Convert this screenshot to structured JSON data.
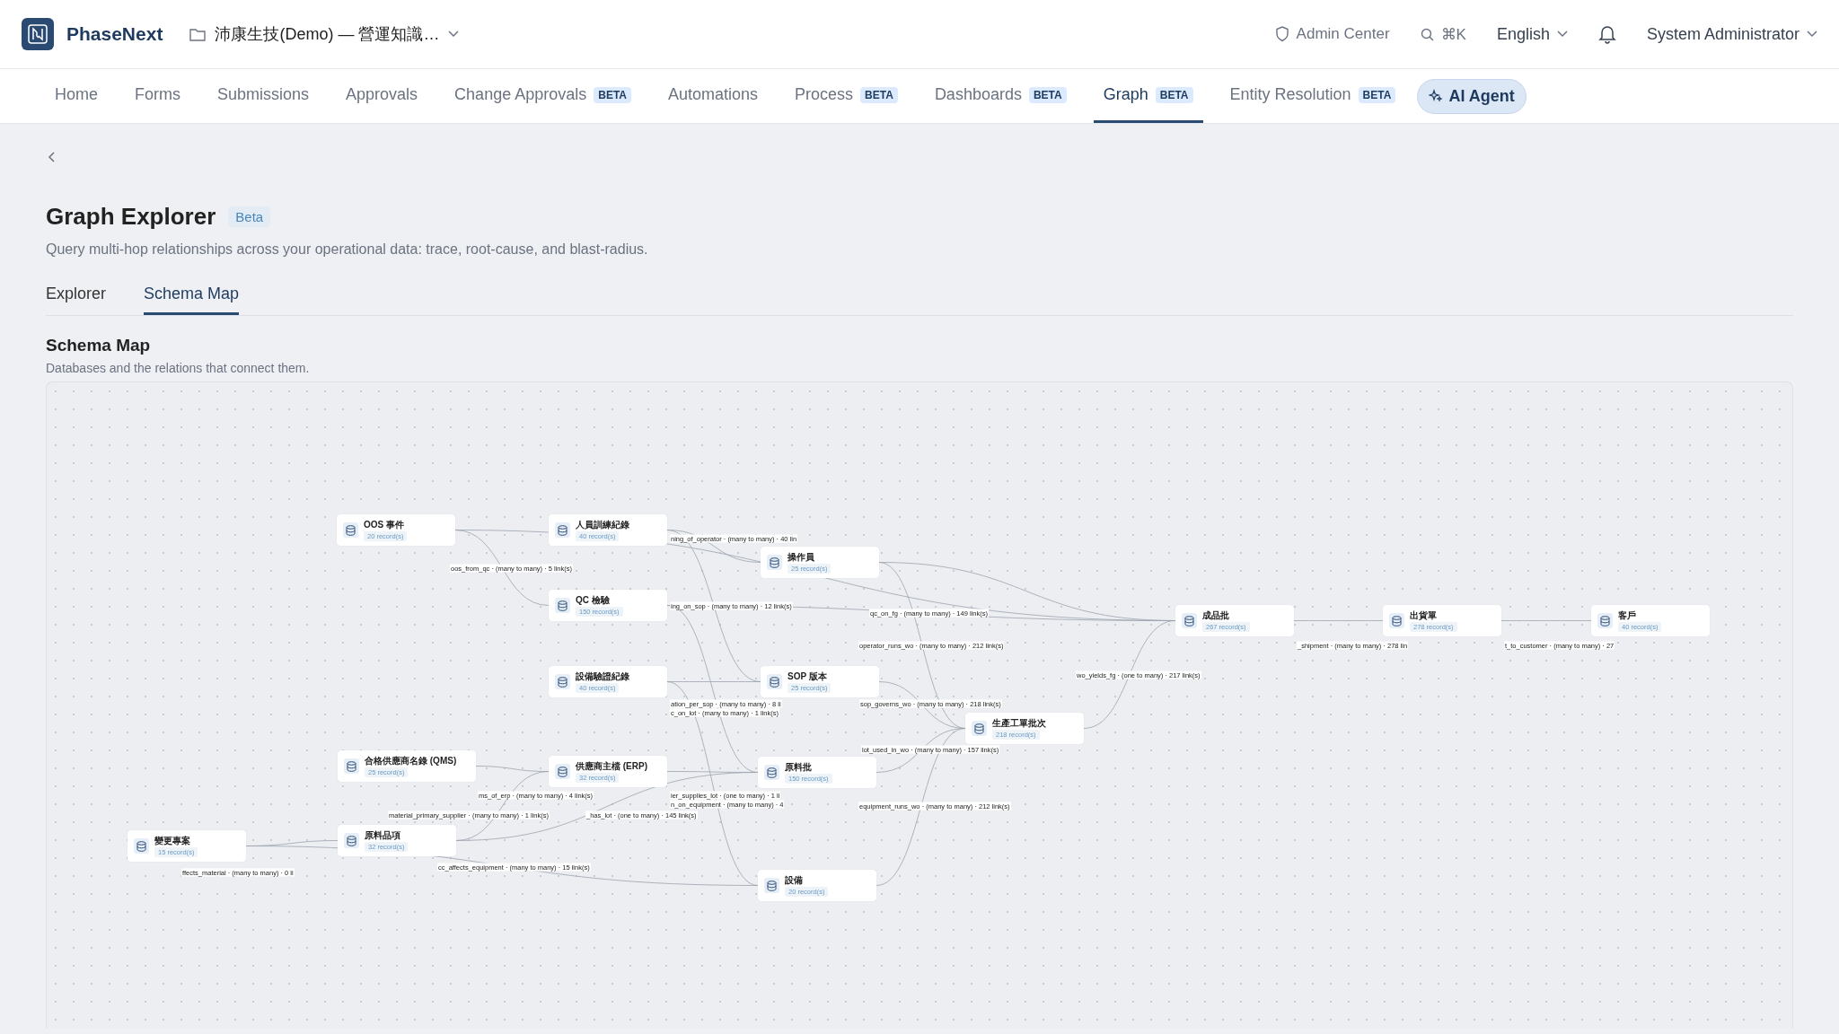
{
  "header": {
    "app_name": "PhaseNext",
    "workspace": "沛康生技(Demo) — 營運知識…",
    "admin_center": "Admin Center",
    "search_shortcut": "⌘K",
    "language": "English",
    "user": "System Administrator"
  },
  "nav": [
    {
      "label": "Home",
      "selected": false
    },
    {
      "label": "Forms",
      "selected": false
    },
    {
      "label": "Submissions",
      "selected": false
    },
    {
      "label": "Approvals",
      "selected": false
    },
    {
      "label": "Change Approvals",
      "badge": "BETA",
      "selected": false
    },
    {
      "label": "Automations",
      "selected": false
    },
    {
      "label": "Process",
      "badge": "BETA",
      "selected": false
    },
    {
      "label": "Dashboards",
      "badge": "BETA",
      "selected": false
    },
    {
      "label": "Graph",
      "badge": "BETA",
      "selected": true
    },
    {
      "label": "Entity Resolution",
      "badge": "BETA",
      "selected": false
    }
  ],
  "ai_agent": {
    "label": "AI Agent"
  },
  "page": {
    "title": "Graph Explorer",
    "badge": "Beta",
    "subtitle": "Query multi-hop relationships across your operational data: trace, root-cause, and blast-radius.",
    "tabs": [
      {
        "label": "Explorer",
        "selected": false
      },
      {
        "label": "Schema Map",
        "selected": true
      }
    ]
  },
  "schema_map": {
    "title": "Schema Map",
    "subtitle": "Databases and the relations that connect them.",
    "nodes": [
      {
        "name": "OOS 事件",
        "records": "20 record(s)"
      },
      {
        "name": "人員訓練紀錄",
        "records": "40 record(s)"
      },
      {
        "name": "操作員",
        "records": "25 record(s)"
      },
      {
        "name": "QC 檢驗",
        "records": "150 record(s)"
      },
      {
        "name": "設備驗證紀錄",
        "records": "40 record(s)"
      },
      {
        "name": "SOP 版本",
        "records": "25 record(s)"
      },
      {
        "name": "生產工單批次",
        "records": "218 record(s)"
      },
      {
        "name": "成品批",
        "records": "267 record(s)"
      },
      {
        "name": "出貨單",
        "records": "278 record(s)"
      },
      {
        "name": "客戶",
        "records": "40 record(s)"
      },
      {
        "name": "合格供應商名錄 (QMS)",
        "records": "25 record(s)"
      },
      {
        "name": "供應商主檔 (ERP)",
        "records": "32 record(s)"
      },
      {
        "name": "原料批",
        "records": "150 record(s)"
      },
      {
        "name": "變更專案",
        "records": "15 record(s)"
      },
      {
        "name": "原料品項",
        "records": "32 record(s)"
      },
      {
        "name": "設備",
        "records": "20 record(s)"
      }
    ],
    "edge_labels": [
      "ning_of_operator · (many to many) · 40 lin",
      "oos_from_qc · (many to many) · 5 link(s)",
      "ing_on_sop · (many to many) · 12 link(s)",
      "qc_on_fg · (many to many) · 149 link(s)",
      "operator_runs_wo · (many to many) · 212 link(s)",
      "_shipment · (many to many) · 278 lin",
      "t_to_customer · (many to many) · 27",
      "wo_yields_fg · (one to many) · 217 link(s)",
      "ation_per_sop · (many to many) · 8 li",
      "c_on_lot · (many to many) · 1 link(s)",
      "sop_governs_wo · (many to many) · 218 link(s)",
      "lot_used_in_wo · (many to many) · 157 link(s)",
      "ms_of_erp · (many to many) · 4 link(s)",
      "ier_supplies_lot · (one to many) · 1 li",
      "n_on_equipment · (many to many) · 4",
      "material_primary_supplier · (many to many) · 1 link(s)",
      "_has_lot · (one to many) · 145 link(s)",
      "equipment_runs_wo · (many to many) · 212 link(s)",
      "ffects_material · (many to many) · 0 li",
      "cc_affects_equipment · (many to many) · 15 link(s)"
    ]
  }
}
